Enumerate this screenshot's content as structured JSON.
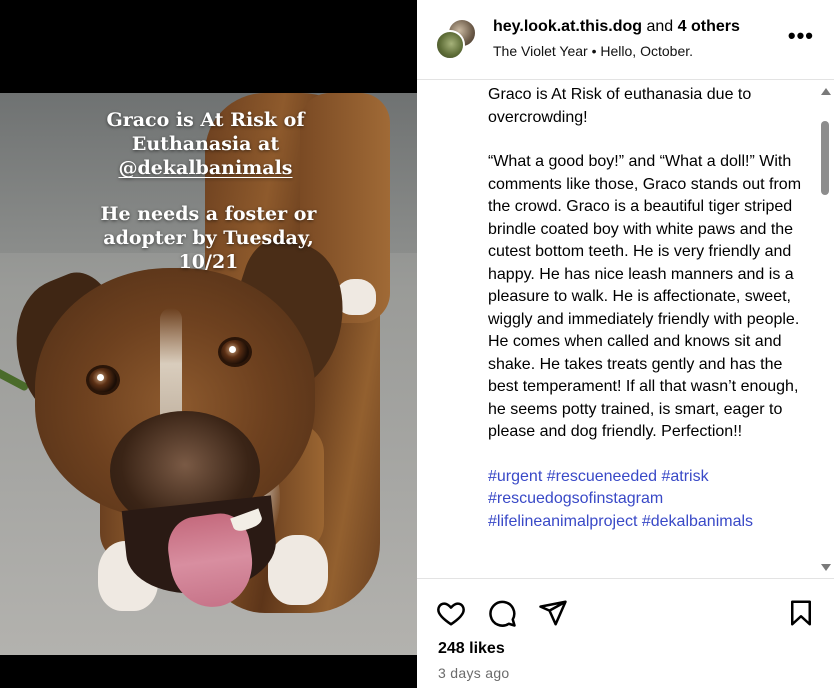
{
  "media": {
    "overlay_line1": "Graco is At Risk of",
    "overlay_line2": "Euthanasia at",
    "overlay_handle": "@dekalbanimals",
    "overlay_line4": "He needs a foster or",
    "overlay_line5": "adopter by Tuesday,",
    "overlay_line6": "10/21"
  },
  "header": {
    "username": "hey.look.at.this.dog",
    "and_text": "and",
    "others": "4 others",
    "audio": "The Violet Year",
    "separator": "•",
    "song": "Hello, October.",
    "more_label": "•••"
  },
  "caption": {
    "p1": "Graco is At Risk of euthanasia due to overcrowding!",
    "p2": "“What a good boy!” and “What a doll!” With comments like those, Graco stands out from the crowd. Graco is a beautiful tiger striped brindle coated boy with white paws and the cutest bottom teeth. He is very friendly and happy. He has nice leash manners and is a pleasure to walk. He is affectionate, sweet, wiggly and immediately friendly with people. He comes when called and knows sit and shake. He takes treats gently and has the best temperament! If all that wasn’t enough, he seems potty trained, is smart, eager to please and dog friendly. Perfection!!",
    "tags_line1": "#urgent #rescueneeded #atrisk",
    "tags_line2": "#rescuedogsofinstagram",
    "tags_line3": "#lifelineanimalproject #dekalbanimals",
    "tag_color": "#3949c7"
  },
  "footer": {
    "likes": "248 likes",
    "time": "3 days ago"
  },
  "icons": {
    "like": "heart-icon",
    "comment": "comment-bubble-icon",
    "share": "paper-plane-icon",
    "save": "bookmark-icon"
  }
}
